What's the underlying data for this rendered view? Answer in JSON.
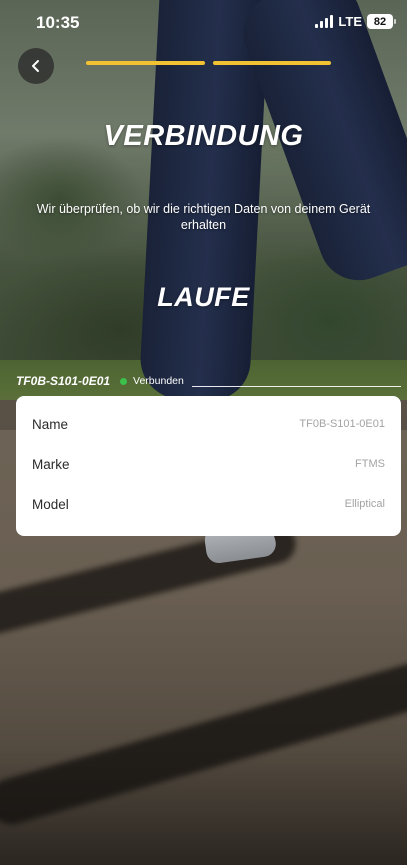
{
  "status_bar": {
    "time": "10:35",
    "network": "LTE",
    "battery": "82"
  },
  "header": {
    "back_icon": "chevron-left-icon",
    "progress": {
      "total_steps": 2,
      "completed_steps": 2,
      "active_color": "#f2c232"
    }
  },
  "main": {
    "title": "VERBINDUNG",
    "subtitle": "Wir überprüfen, ob wir die richtigen Daten von deinem Gerät erhalten",
    "activity": "LAUFE"
  },
  "device": {
    "id": "TF0B-S101-0E01",
    "status": "Verbunden",
    "status_color": "#3cc24a",
    "details": [
      {
        "label": "Name",
        "value": "TF0B-S101-0E01"
      },
      {
        "label": "Marke",
        "value": "FTMS"
      },
      {
        "label": "Model",
        "value": "Elliptical"
      }
    ]
  }
}
